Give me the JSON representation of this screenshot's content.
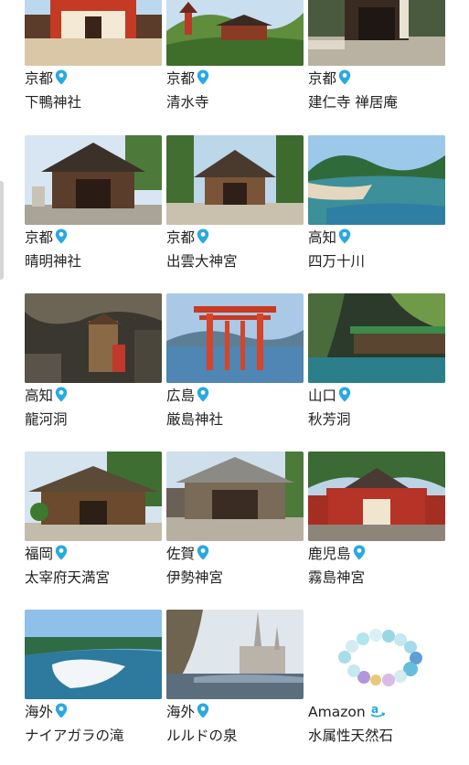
{
  "items": [
    {
      "region": "京都",
      "name": "下鴨神社"
    },
    {
      "region": "京都",
      "name": "清水寺"
    },
    {
      "region": "京都",
      "name": "建仁寺 禅居庵"
    },
    {
      "region": "京都",
      "name": "晴明神社"
    },
    {
      "region": "京都",
      "name": "出雲大神宮"
    },
    {
      "region": "高知",
      "name": "四万十川"
    },
    {
      "region": "高知",
      "name": "龍河洞"
    },
    {
      "region": "広島",
      "name": "厳島神社"
    },
    {
      "region": "山口",
      "name": "秋芳洞"
    },
    {
      "region": "福岡",
      "name": "太宰府天満宮"
    },
    {
      "region": "佐賀",
      "name": "伊勢神宮"
    },
    {
      "region": "鹿児島",
      "name": "霧島神宮"
    },
    {
      "region": "海外",
      "name": "ナイアガラの滝"
    },
    {
      "region": "海外",
      "name": "ルルドの泉"
    },
    {
      "region": "Amazon",
      "name": "水属性天然石"
    }
  ],
  "colors": {
    "pin": "#29a9e0",
    "amazon": "#1fa8dc",
    "text": "#222222"
  },
  "icons": {
    "location": "map-pin-icon",
    "shop": "amazon-logo-icon"
  }
}
